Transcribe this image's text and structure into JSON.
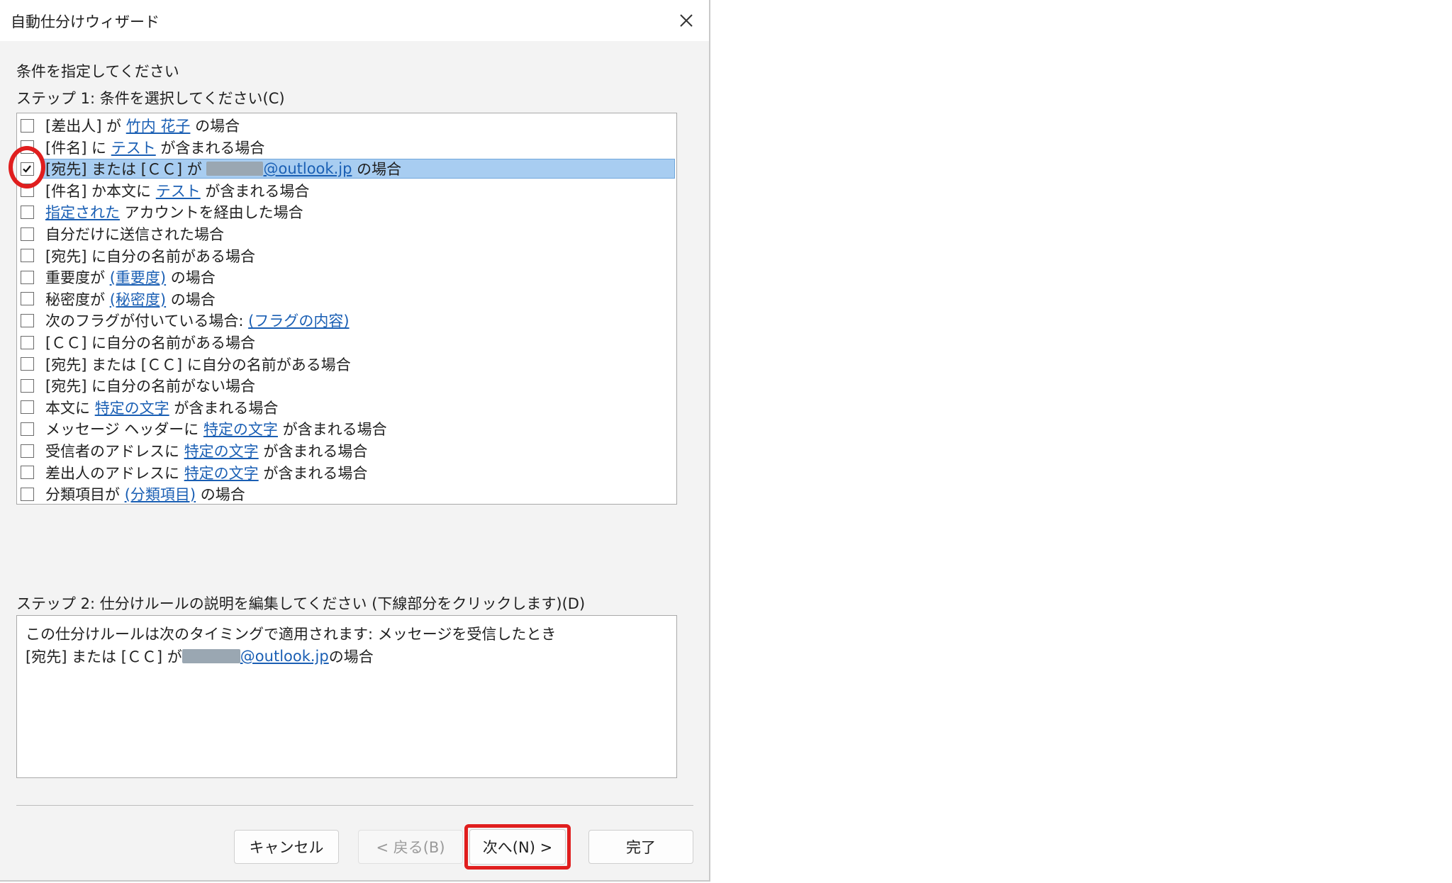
{
  "dialog": {
    "title": "自動仕分けウィザード",
    "instruction": "条件を指定してください",
    "step1_label": "ステップ 1: 条件を選択してください(C)",
    "step2_label": "ステップ 2: 仕分けルールの説明を編集してください (下線部分をクリックします)(D)"
  },
  "conditions": [
    {
      "checked": false,
      "parts": [
        {
          "t": "[差出人] が "
        },
        {
          "t": "竹内 花子",
          "link": true
        },
        {
          "t": " の場合"
        }
      ]
    },
    {
      "checked": false,
      "parts": [
        {
          "t": "[件名] に "
        },
        {
          "t": "テスト",
          "link": true
        },
        {
          "t": " が含まれる場合"
        }
      ]
    },
    {
      "checked": true,
      "selected": true,
      "parts": [
        {
          "t": "[宛先] または [ＣＣ] が "
        },
        {
          "t": "",
          "blur": true,
          "link": true
        },
        {
          "t": "@outlook.jp",
          "link": true
        },
        {
          "t": " の場合"
        }
      ]
    },
    {
      "checked": false,
      "parts": [
        {
          "t": "[件名] か本文に "
        },
        {
          "t": "テスト",
          "link": true
        },
        {
          "t": " が含まれる場合"
        }
      ]
    },
    {
      "checked": false,
      "parts": [
        {
          "t": "指定された",
          "link": true
        },
        {
          "t": " アカウントを経由した場合"
        }
      ]
    },
    {
      "checked": false,
      "parts": [
        {
          "t": "自分だけに送信された場合"
        }
      ]
    },
    {
      "checked": false,
      "parts": [
        {
          "t": "[宛先] に自分の名前がある場合"
        }
      ]
    },
    {
      "checked": false,
      "parts": [
        {
          "t": "重要度が "
        },
        {
          "t": "(重要度)",
          "link": true
        },
        {
          "t": " の場合"
        }
      ]
    },
    {
      "checked": false,
      "parts": [
        {
          "t": "秘密度が "
        },
        {
          "t": "(秘密度)",
          "link": true
        },
        {
          "t": " の場合"
        }
      ]
    },
    {
      "checked": false,
      "parts": [
        {
          "t": "次のフラグが付いている場合: "
        },
        {
          "t": "(フラグの内容)",
          "link": true
        }
      ]
    },
    {
      "checked": false,
      "parts": [
        {
          "t": "[ＣＣ] に自分の名前がある場合"
        }
      ]
    },
    {
      "checked": false,
      "parts": [
        {
          "t": "[宛先] または [ＣＣ] に自分の名前がある場合"
        }
      ]
    },
    {
      "checked": false,
      "parts": [
        {
          "t": "[宛先] に自分の名前がない場合"
        }
      ]
    },
    {
      "checked": false,
      "parts": [
        {
          "t": "本文に "
        },
        {
          "t": "特定の文字",
          "link": true
        },
        {
          "t": " が含まれる場合"
        }
      ]
    },
    {
      "checked": false,
      "parts": [
        {
          "t": "メッセージ ヘッダーに "
        },
        {
          "t": "特定の文字",
          "link": true
        },
        {
          "t": " が含まれる場合"
        }
      ]
    },
    {
      "checked": false,
      "parts": [
        {
          "t": "受信者のアドレスに "
        },
        {
          "t": "特定の文字",
          "link": true
        },
        {
          "t": " が含まれる場合"
        }
      ]
    },
    {
      "checked": false,
      "parts": [
        {
          "t": "差出人のアドレスに "
        },
        {
          "t": "特定の文字",
          "link": true
        },
        {
          "t": " が含まれる場合"
        }
      ]
    },
    {
      "checked": false,
      "parts": [
        {
          "t": "分類項目が "
        },
        {
          "t": "(分類項目)",
          "link": true
        },
        {
          "t": " の場合"
        }
      ]
    }
  ],
  "description": {
    "line1": "この仕分けルールは次のタイミングで適用されます: メッセージを受信したとき",
    "line2_prefix": "[宛先] または [ＣＣ] が ",
    "line2_link": "@outlook.jp",
    "line2_suffix": " の場合"
  },
  "buttons": {
    "cancel": "キャンセル",
    "back": "< 戻る(B)",
    "next": "次へ(N) >",
    "finish": "完了"
  },
  "colors": {
    "link": "#1a5fb4",
    "selection": "#a8cdf1",
    "annotation": "#e01e1e"
  }
}
